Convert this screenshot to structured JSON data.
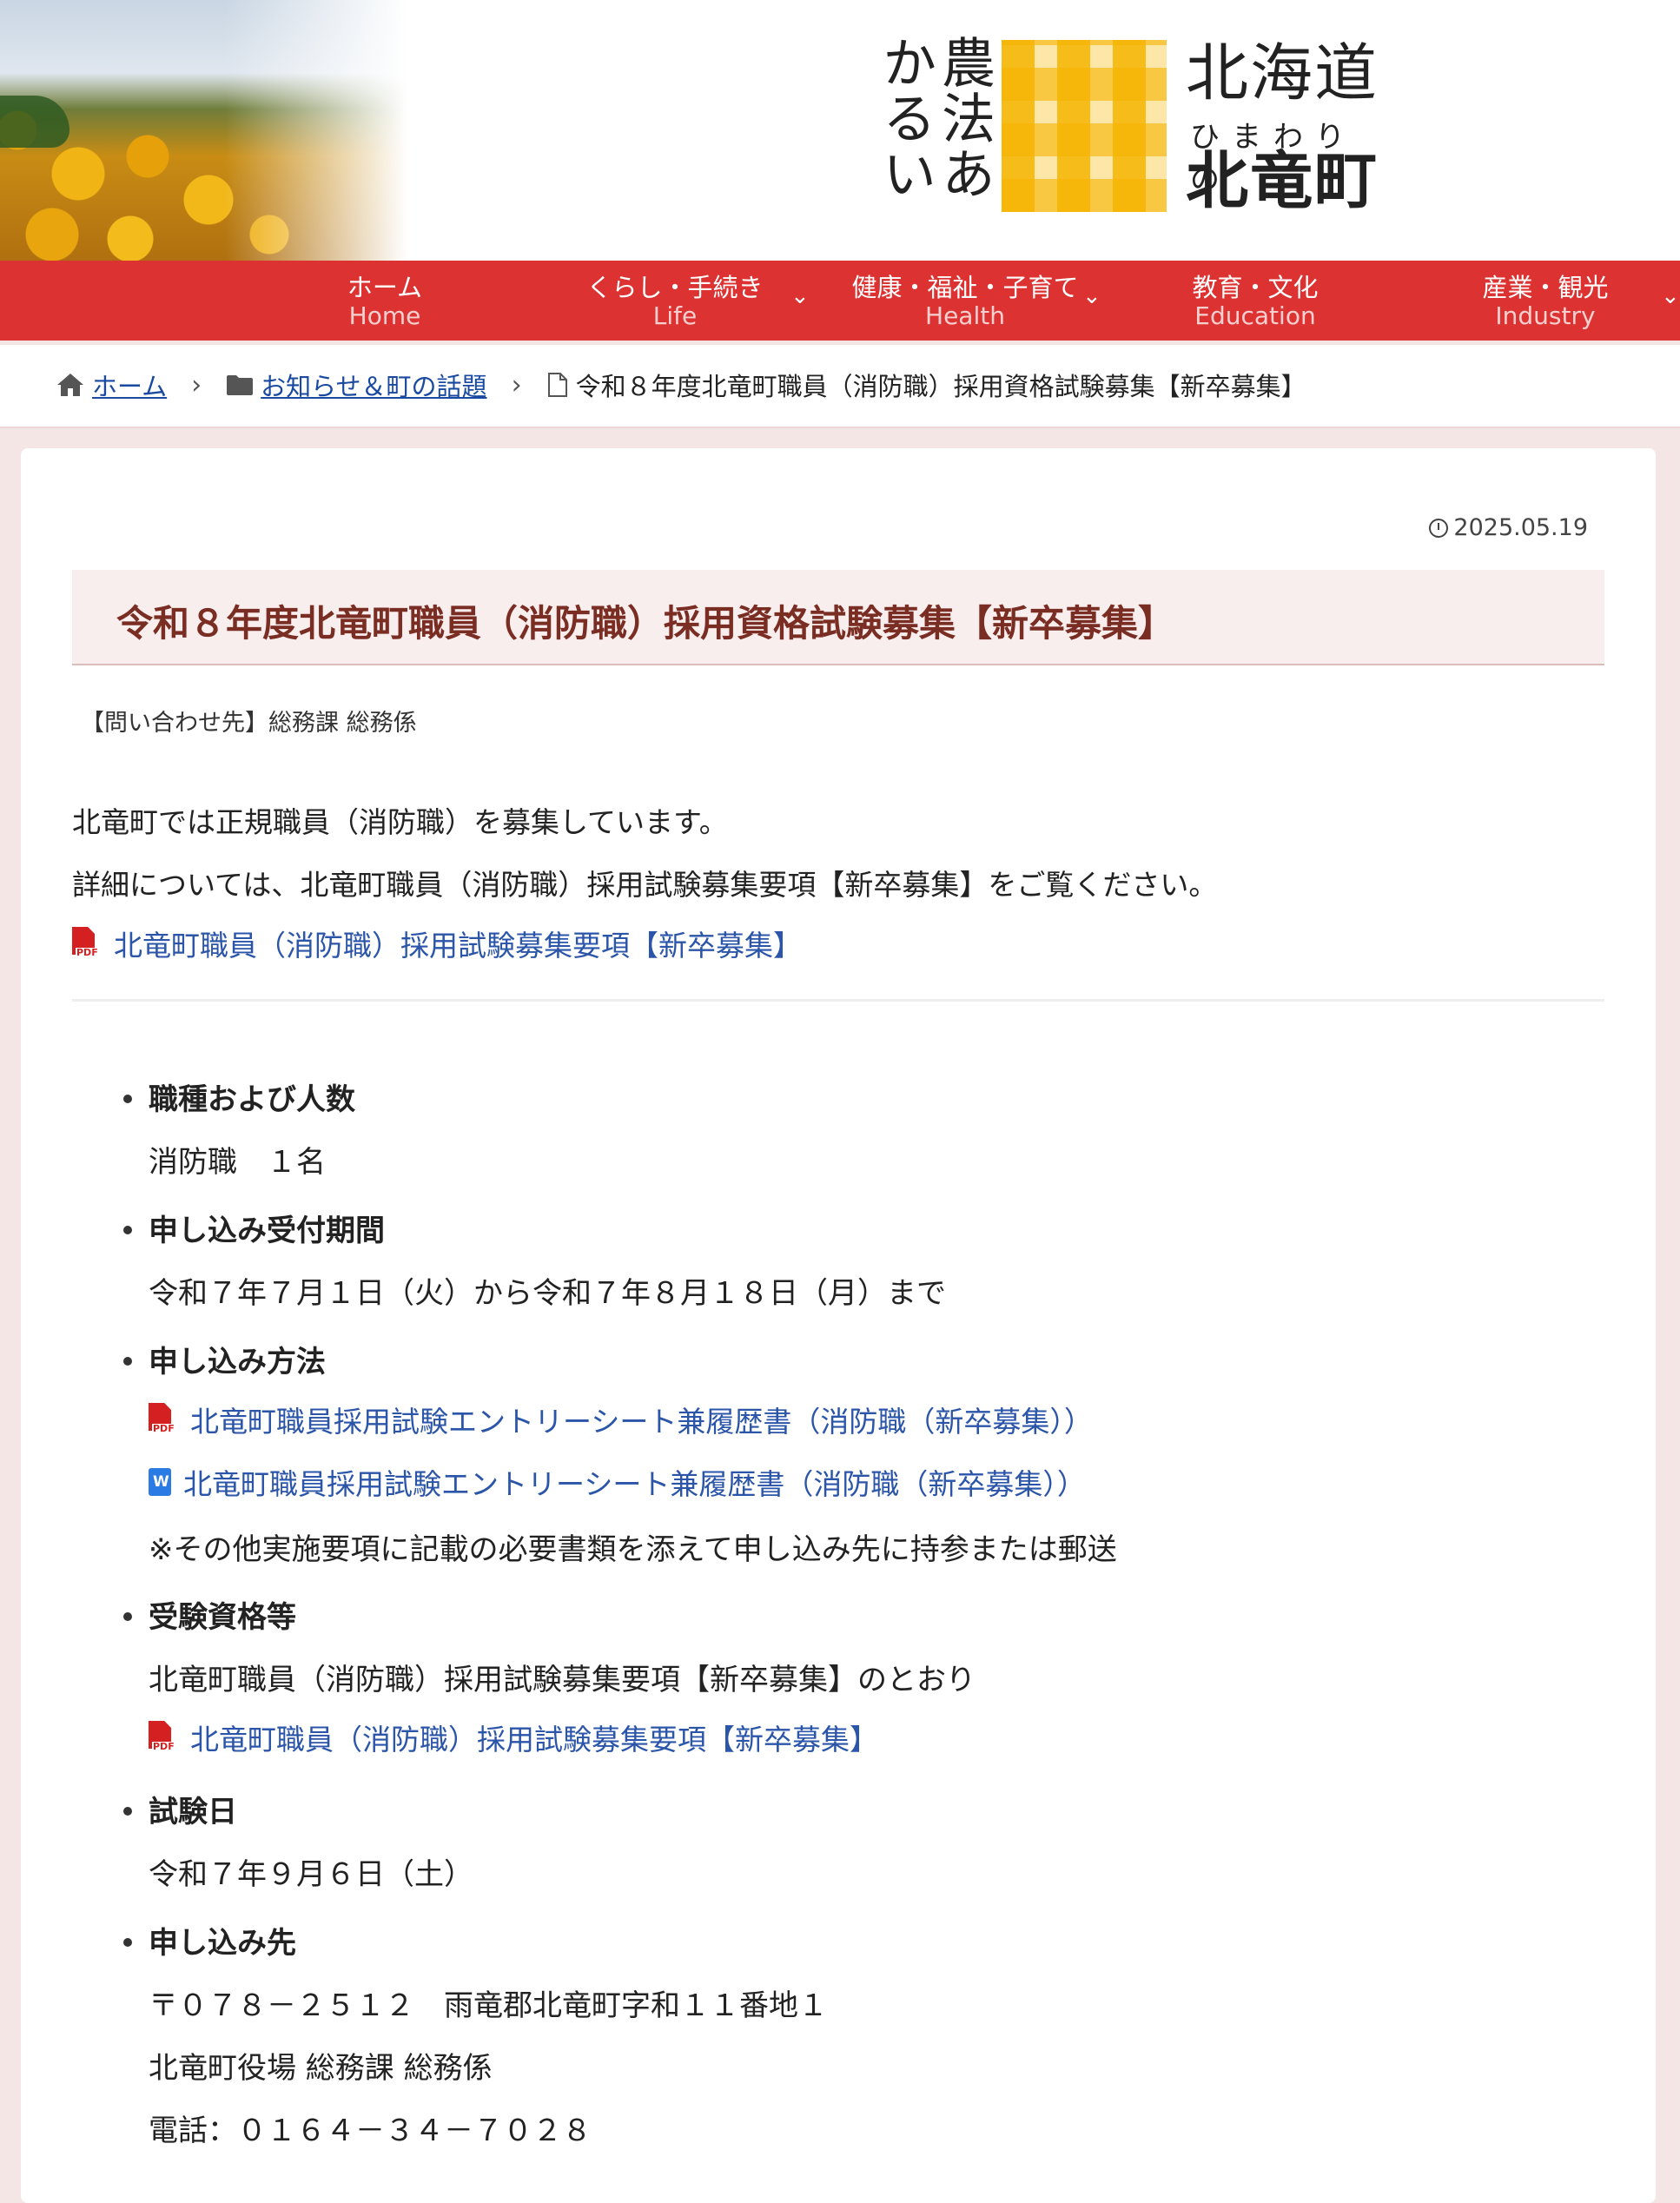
{
  "header": {
    "logo_tagline": "農法あかるい",
    "logo_region": "北海道",
    "logo_sub": "ひまわりの",
    "logo_town": "北竜町"
  },
  "nav": {
    "items": [
      {
        "jp": "ホーム",
        "en": "Home"
      },
      {
        "jp": "くらし・手続き",
        "en": "Life"
      },
      {
        "jp": "健康・福祉・子育て",
        "en": "Health"
      },
      {
        "jp": "教育・文化",
        "en": "Education"
      },
      {
        "jp": "産業・観光",
        "en": "Industry"
      }
    ]
  },
  "breadcrumb": {
    "home": "ホーム",
    "category": "お知らせ＆町の話題",
    "current": "令和８年度北竜町職員（消防職）採用資格試験募集【新卒募集】"
  },
  "article": {
    "date": "2025.05.19",
    "title": "令和８年度北竜町職員（消防職）採用資格試験募集【新卒募集】",
    "contact": "【問い合わせ先】総務課 総務係",
    "intro1": "北竜町では正規職員（消防職）を募集しています。",
    "intro2": "詳細については、北竜町職員（消防職）採用試験募集要項【新卒募集】をご覧ください。",
    "guide_link": "北竜町職員（消防職）採用試験募集要項【新卒募集】",
    "pdf_label": "PDF",
    "sections": {
      "job": {
        "heading": "職種および人数",
        "body": "消防職　１名"
      },
      "period": {
        "heading": "申し込み受付期間",
        "body": "令和７年７月１日（火）から令和７年８月１８日（月）まで"
      },
      "method": {
        "heading": "申し込み方法",
        "pdf_link": "北竜町職員採用試験エントリーシート兼履歴書（消防職（新卒募集））",
        "word_link": "北竜町職員採用試験エントリーシート兼履歴書（消防職（新卒募集））",
        "note": "※その他実施要項に記載の必要書類を添えて申し込み先に持参または郵送"
      },
      "qualification": {
        "heading": "受験資格等",
        "body": "北竜町職員（消防職）採用試験募集要項【新卒募集】のとおり",
        "link": "北竜町職員（消防職）採用試験募集要項【新卒募集】"
      },
      "exam_date": {
        "heading": "試験日",
        "body": "令和７年９月６日（土）"
      },
      "apply_to": {
        "heading": "申し込み先",
        "address": "〒０７８－２５１２　雨竜郡北竜町字和１１番地１",
        "office": "北竜町役場 総務課 総務係",
        "phone": "電話：０１６４－３４－７０２８"
      }
    }
  }
}
